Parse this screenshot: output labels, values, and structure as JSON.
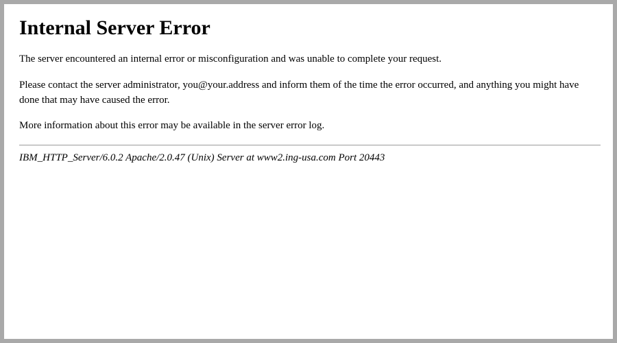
{
  "error": {
    "title": "Internal Server Error",
    "paragraphs": {
      "p1": "The server encountered an internal error or misconfiguration and was unable to complete your request.",
      "p2": "Please contact the server administrator, you@your.address and inform them of the time the error occurred, and anything you might have done that may have caused the error.",
      "p3": "More information about this error may be available in the server error log."
    },
    "server_signature": "IBM_HTTP_Server/6.0.2 Apache/2.0.47 (Unix) Server at www2.ing-usa.com Port 20443"
  }
}
